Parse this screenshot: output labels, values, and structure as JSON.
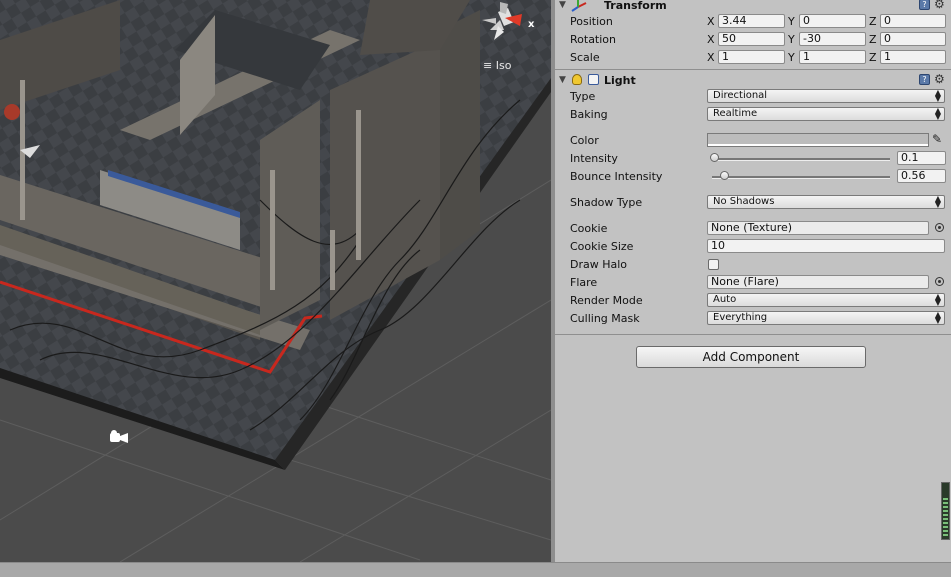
{
  "scene": {
    "view_mode": "Iso",
    "gizmo_axis": "x"
  },
  "transform": {
    "title": "Transform",
    "position": {
      "label": "Position",
      "x": "3.44",
      "y": "0",
      "z": "0"
    },
    "rotation": {
      "label": "Rotation",
      "x": "50",
      "y": "-30",
      "z": "0"
    },
    "scale": {
      "label": "Scale",
      "x": "1",
      "y": "1",
      "z": "1"
    },
    "axis_x": "X",
    "axis_y": "Y",
    "axis_z": "Z"
  },
  "light": {
    "title": "Light",
    "type": {
      "label": "Type",
      "value": "Directional"
    },
    "baking": {
      "label": "Baking",
      "value": "Realtime"
    },
    "color": {
      "label": "Color",
      "value": "#bcbcbc"
    },
    "intensity": {
      "label": "Intensity",
      "value": "0.1",
      "fraction": 0.0125
    },
    "bounce": {
      "label": "Bounce Intensity",
      "value": "0.56",
      "fraction": 0.07
    },
    "shadow_type": {
      "label": "Shadow Type",
      "value": "No Shadows"
    },
    "cookie": {
      "label": "Cookie",
      "value": "None (Texture)"
    },
    "cookie_size": {
      "label": "Cookie Size",
      "value": "10"
    },
    "draw_halo": {
      "label": "Draw Halo",
      "checked": false
    },
    "flare": {
      "label": "Flare",
      "value": "None (Flare)"
    },
    "render_mode": {
      "label": "Render Mode",
      "value": "Auto"
    },
    "culling_mask": {
      "label": "Culling Mask",
      "value": "Everything"
    }
  },
  "add_component_label": "Add Component",
  "colors": {
    "inspector_bg": "#c2c2c2",
    "scene_bg": "#4a4a4a",
    "accent_red": "#c8281e"
  }
}
